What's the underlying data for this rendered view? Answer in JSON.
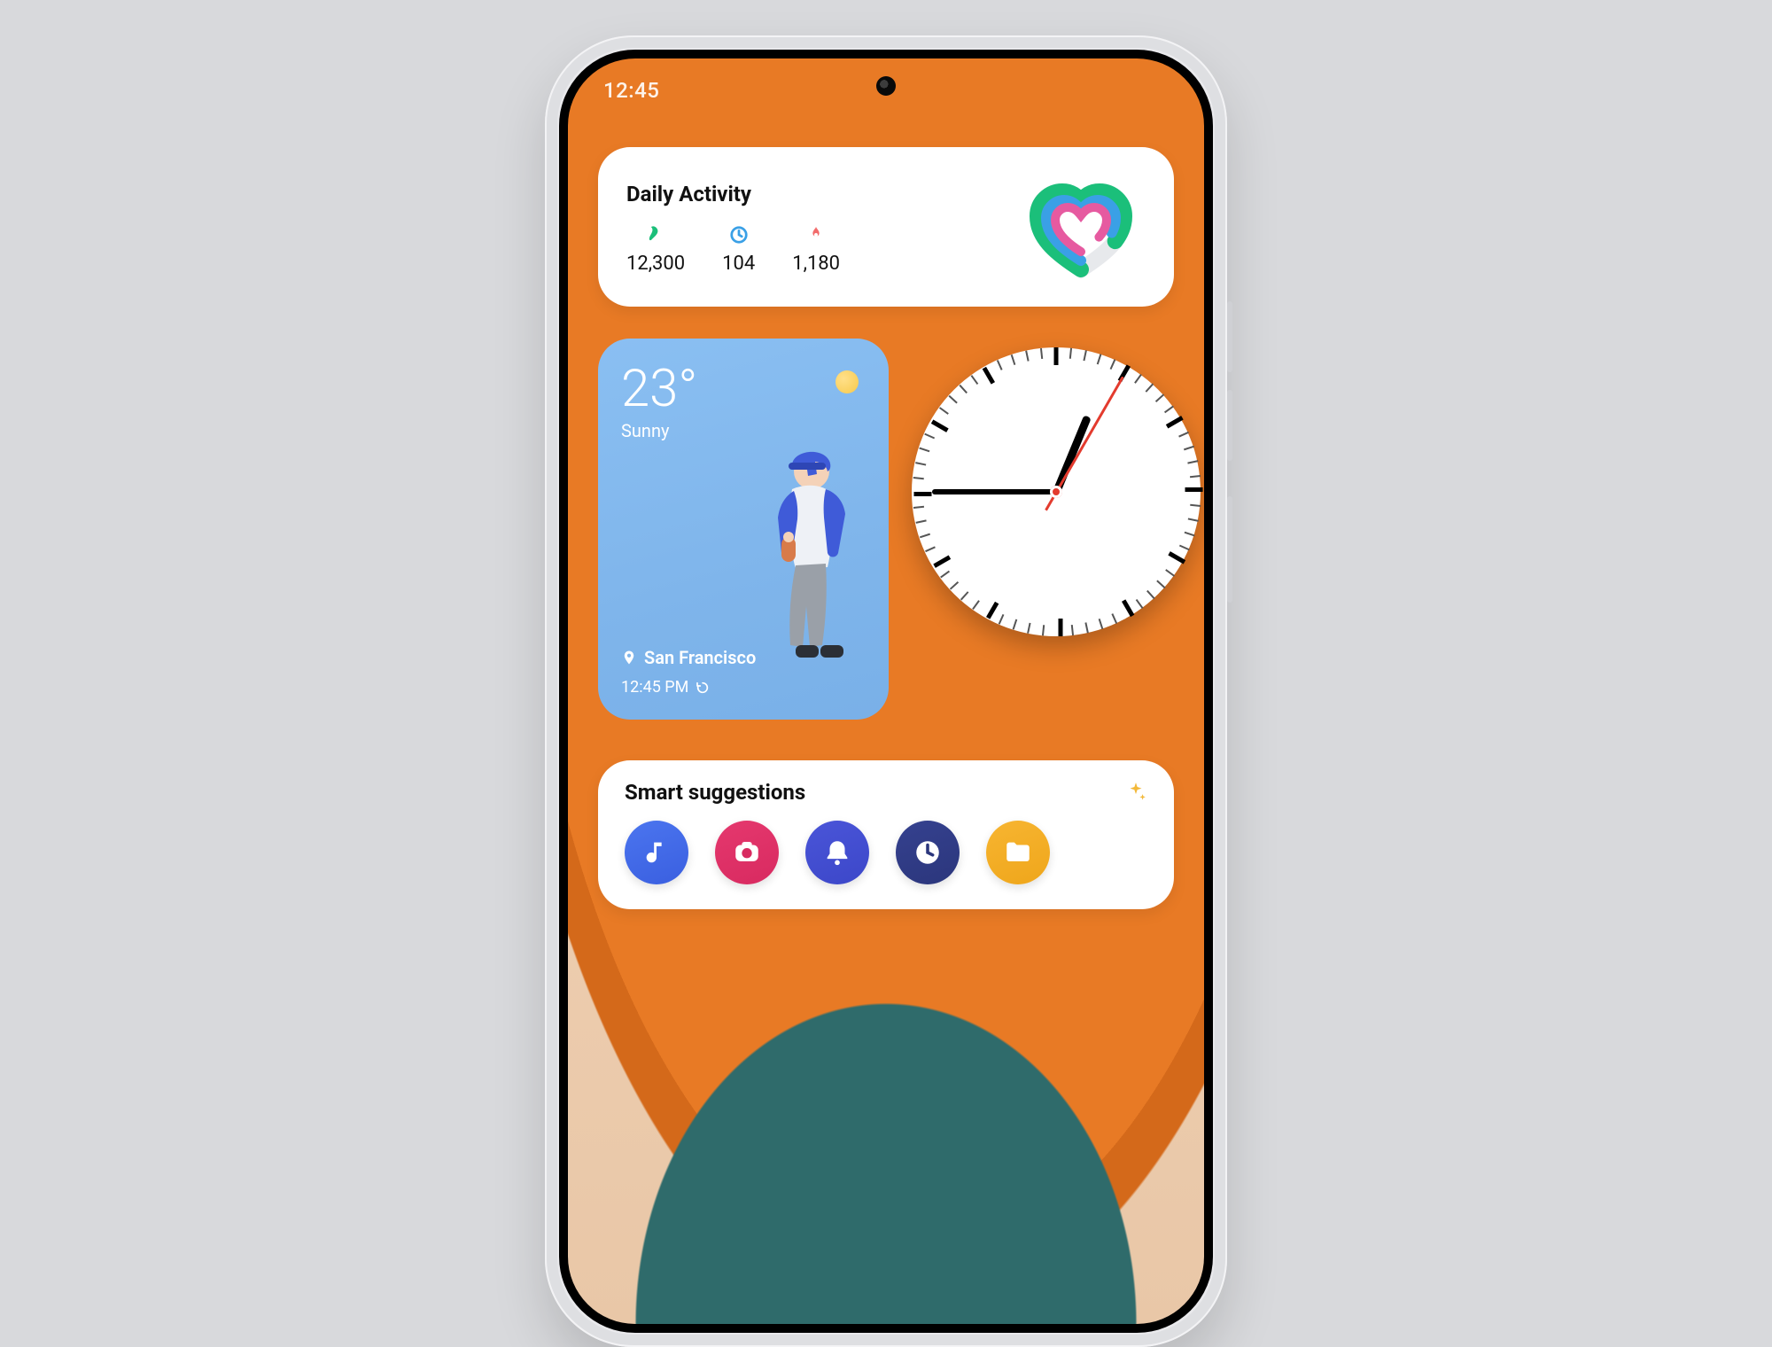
{
  "status": {
    "time": "12:45"
  },
  "activity": {
    "title": "Daily Activity",
    "metrics": {
      "steps": "12,300",
      "minutes": "104",
      "calories": "1,180"
    }
  },
  "weather": {
    "temp": "23°",
    "condition": "Sunny",
    "location": "San Francisco",
    "time": "12:45 PM"
  },
  "clock": {
    "hour": 12,
    "minute": 45,
    "second": 5
  },
  "suggestions": {
    "title": "Smart suggestions",
    "apps": [
      "music",
      "camera",
      "notifications",
      "clock",
      "files"
    ]
  },
  "colors": {
    "card": "#ffffff",
    "accentGreen": "#1bbf7a",
    "accentBlue": "#3aa0e6",
    "accentPink": "#e65aa0",
    "flame": "#f05a5a"
  }
}
